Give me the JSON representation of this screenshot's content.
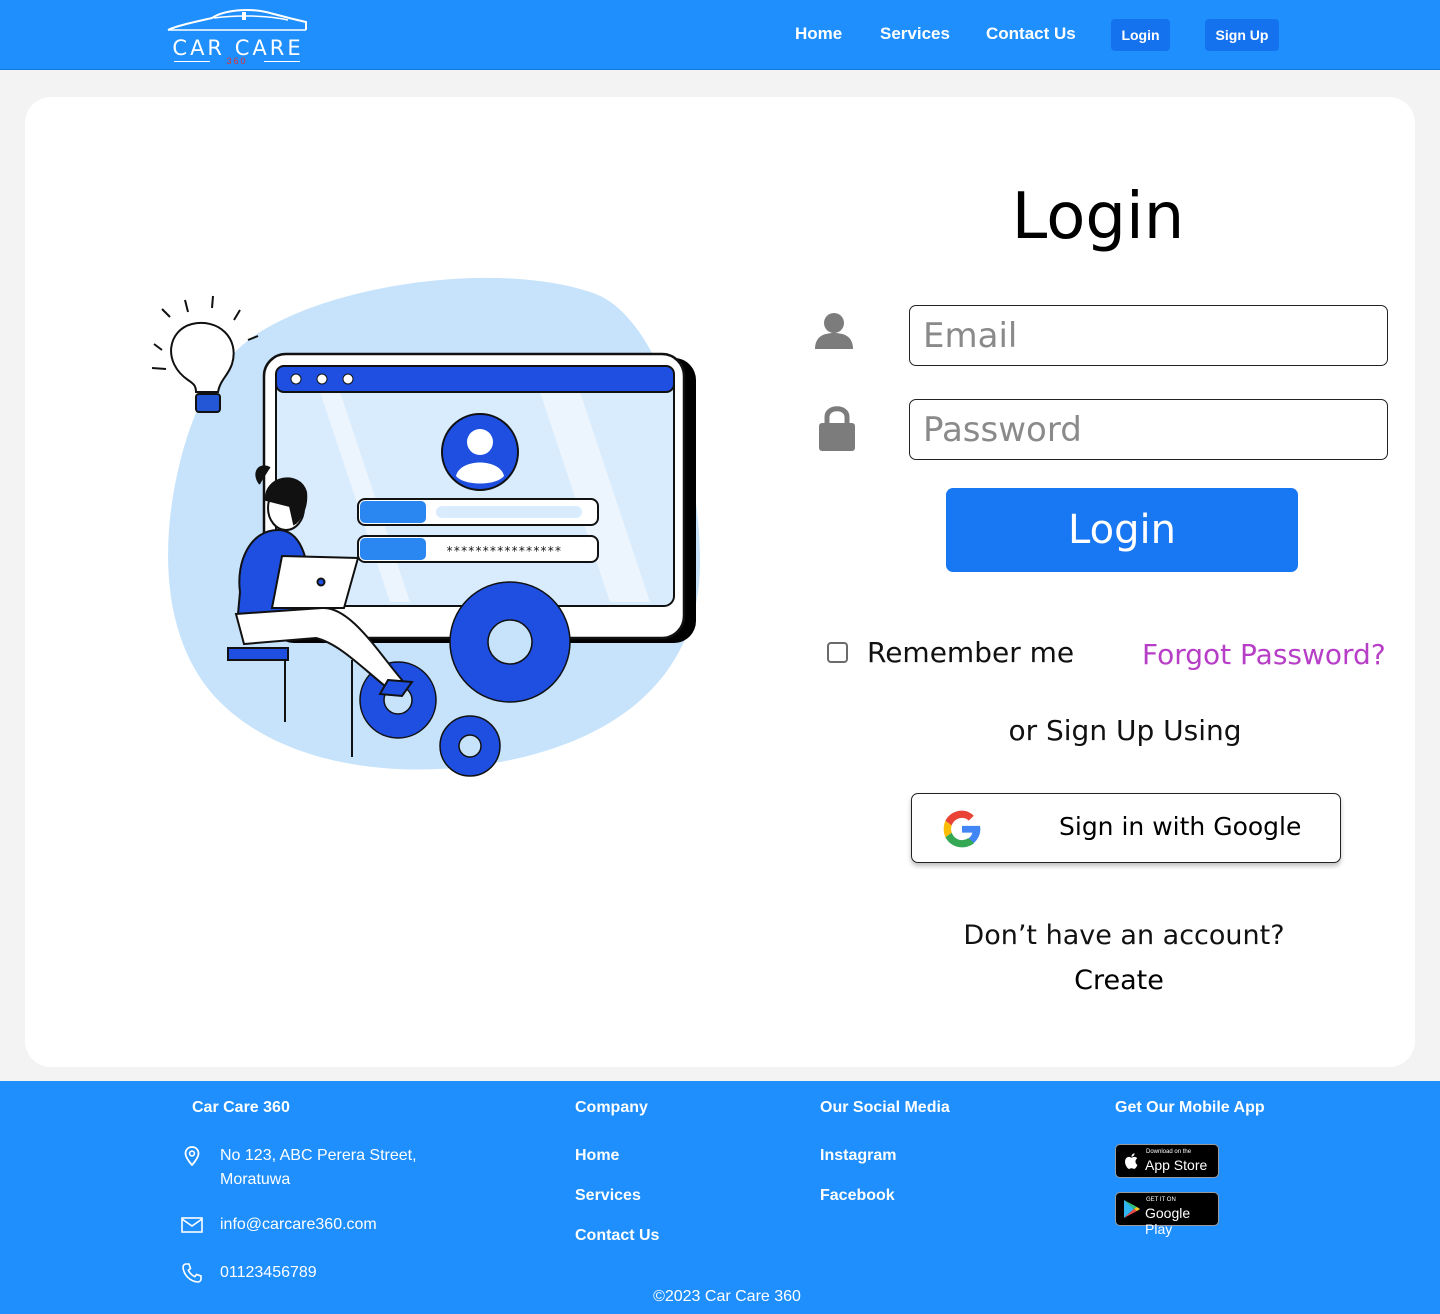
{
  "header": {
    "logo_text": "CAR CARE",
    "logo_sub": "360",
    "nav": [
      "Home",
      "Services",
      "Contact Us"
    ],
    "login_button": "Login",
    "signup_button": "Sign Up"
  },
  "login_form": {
    "title": "Login",
    "email_placeholder": "Email",
    "password_placeholder": "Password",
    "submit_label": "Login",
    "remember_label": "Remember me",
    "forgot_label": "Forgot Password?",
    "or_text": "or Sign Up Using",
    "google_label": "Sign in with Google",
    "no_account_text": "Don’t have an account?",
    "create_label": "Create"
  },
  "illustration": {
    "password_mask": "****************"
  },
  "footer": {
    "brand": "Car Care 360",
    "address_line1": "No 123, ABC Perera Street,",
    "address_line2": "Moratuwa",
    "email": "info@carcare360.com",
    "phone": "01123456789",
    "company_heading": "Company",
    "company_links": [
      "Home",
      "Services",
      "Contact Us"
    ],
    "social_heading": "Our Social Media",
    "social_links": [
      "Instagram",
      "Facebook"
    ],
    "app_heading": "Get Our Mobile App",
    "app_store": {
      "small": "Download on the",
      "big": "App Store"
    },
    "google_play": {
      "small": "GET IT ON",
      "big": "Google Play"
    },
    "copyright": "©2023 Car Care 360"
  },
  "colors": {
    "primary": "#1e8ffd",
    "button": "#1877f2",
    "forgot_link": "#b73ec7",
    "card_background": "#ffffff",
    "page_background": "#f4f3f3"
  },
  "icons": [
    "car-logo-icon",
    "user-icon",
    "lock-icon",
    "google-g-icon",
    "location-pin-icon",
    "mail-icon",
    "phone-icon",
    "apple-icon",
    "google-play-icon"
  ]
}
